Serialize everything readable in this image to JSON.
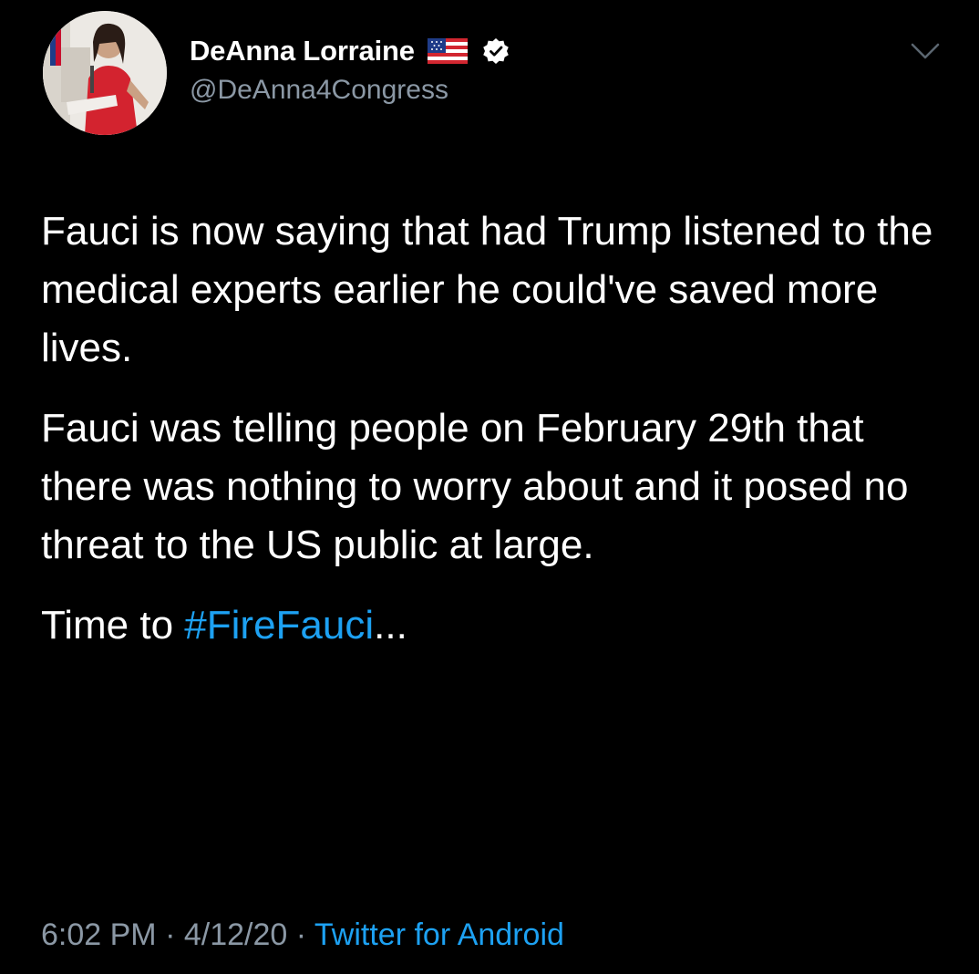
{
  "tweet": {
    "author": {
      "display_name": "DeAnna Lorraine",
      "handle": "@DeAnna4Congress",
      "flag_icon": "us-flag-icon",
      "verified_icon": "verified-badge-icon"
    },
    "menu_icon": "chevron-down-icon",
    "body": {
      "paragraph_1": "Fauci is now saying that had Trump listened to the medical experts earlier he could've saved more lives.",
      "paragraph_2": "Fauci was telling people on February 29th that there was nothing to worry about and it posed no threat to the US public at large.",
      "paragraph_3_prefix": "Time to ",
      "hashtag": "#FireFauci",
      "paragraph_3_suffix": "..."
    },
    "meta": {
      "time": "6:02 PM",
      "separator_1": " · ",
      "date": "4/12/20",
      "separator_2": " · ",
      "source": "Twitter for Android"
    }
  },
  "colors": {
    "background": "#000000",
    "text": "#ffffff",
    "secondary_text": "#8b98a5",
    "link": "#1da1f2"
  }
}
